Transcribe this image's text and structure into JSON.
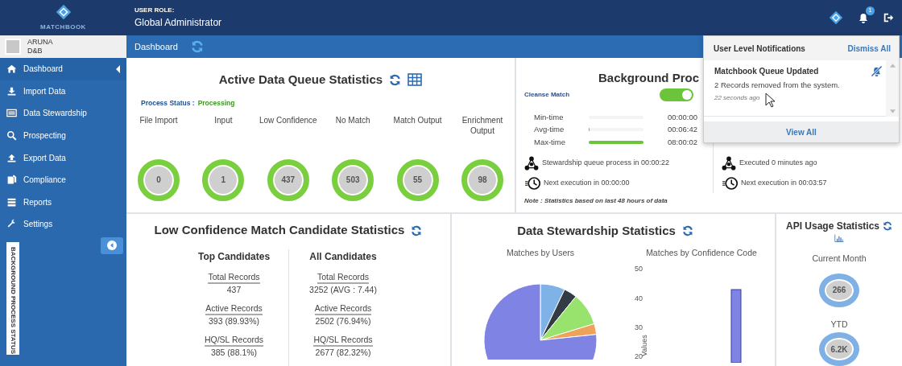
{
  "header": {
    "logo": "MATCHBOOK",
    "role_label": "USER ROLE:",
    "role": "Global Administrator",
    "badge": "1"
  },
  "user": {
    "name": "ARUNA",
    "org": "D&B"
  },
  "breadcrumb": "Dashboard",
  "sidebar": {
    "items": [
      {
        "label": "Dashboard",
        "selected": true
      },
      {
        "label": "Import Data",
        "selected": false
      },
      {
        "label": "Data Stewardship",
        "selected": false
      },
      {
        "label": "Prospecting",
        "selected": false
      },
      {
        "label": "Export Data",
        "selected": false
      },
      {
        "label": "Compliance",
        "selected": false
      },
      {
        "label": "Reports",
        "selected": false
      },
      {
        "label": "Settings",
        "selected": false
      }
    ],
    "vertical_tab": "BACKGROUND PROCESS STATUS"
  },
  "queue": {
    "title": "Active Data Queue Statistics",
    "status_label": "Process Status :",
    "status": "Processing",
    "items": [
      {
        "label": "File Import",
        "value": "0"
      },
      {
        "label": "Input",
        "value": "1"
      },
      {
        "label": "Low Confidence",
        "value": "437"
      },
      {
        "label": "No Match",
        "value": "503"
      },
      {
        "label": "Match Output",
        "value": "55"
      },
      {
        "label": "Enrichment Output",
        "value": "98"
      }
    ]
  },
  "background": {
    "title": "Background Proc",
    "process": "Cleanse Match",
    "toggle": {
      "on": true
    },
    "rows": [
      {
        "label": "Min-time",
        "level": 0,
        "value": "00:00:00"
      },
      {
        "label": "Avg-time",
        "level": 0.02,
        "value": "00:06:42"
      },
      {
        "label": "Max-time",
        "level": 1,
        "value": "08:00:02"
      }
    ],
    "left": {
      "info": "Stewardship queue process in 00:00:22",
      "next": "Next execution in 00:00:00"
    },
    "right": {
      "info": "Executed 0 minutes ago",
      "next": "Next execution in 00:03:57"
    },
    "note": "Note : Statistics based on last 48 hours of data"
  },
  "notifications": {
    "title": "User Level Notifications",
    "dismiss": "Dismiss All",
    "items": [
      {
        "title": "Matchbook Queue Updated",
        "text": "2 Records removed from the system.",
        "time": "22 seconds ago"
      }
    ],
    "view_all": "View All"
  },
  "low_confidence": {
    "title": "Low Confidence Match Candidate Statistics",
    "columns": [
      {
        "heading": "Top Candidates",
        "stats": [
          {
            "label": "Total Records",
            "value": "437"
          },
          {
            "label": "Active Records",
            "value": "393 (89.93%)"
          },
          {
            "label": "HQ/SL Records",
            "value": "385 (88.1%)"
          }
        ]
      },
      {
        "heading": "All Candidates",
        "stats": [
          {
            "label": "Total Records",
            "value": "3252 (AVG : 7.44)"
          },
          {
            "label": "Active Records",
            "value": "2502 (76.94%)"
          },
          {
            "label": "HQ/SL Records",
            "value": "2677 (82.32%)"
          }
        ]
      }
    ]
  },
  "stewardship": {
    "title": "Data Stewardship Statistics",
    "users_chart_title": "Matches by Users",
    "confidence_chart": {
      "title": "Matches by Confidence Code",
      "axis_title": "Values",
      "ticks": [
        "50",
        "40",
        "30",
        "20"
      ]
    }
  },
  "api": {
    "title": "API Usage Statistics",
    "items": [
      {
        "label": "Current Month",
        "value": "266"
      },
      {
        "label": "YTD",
        "value": "6.2K"
      }
    ]
  }
}
